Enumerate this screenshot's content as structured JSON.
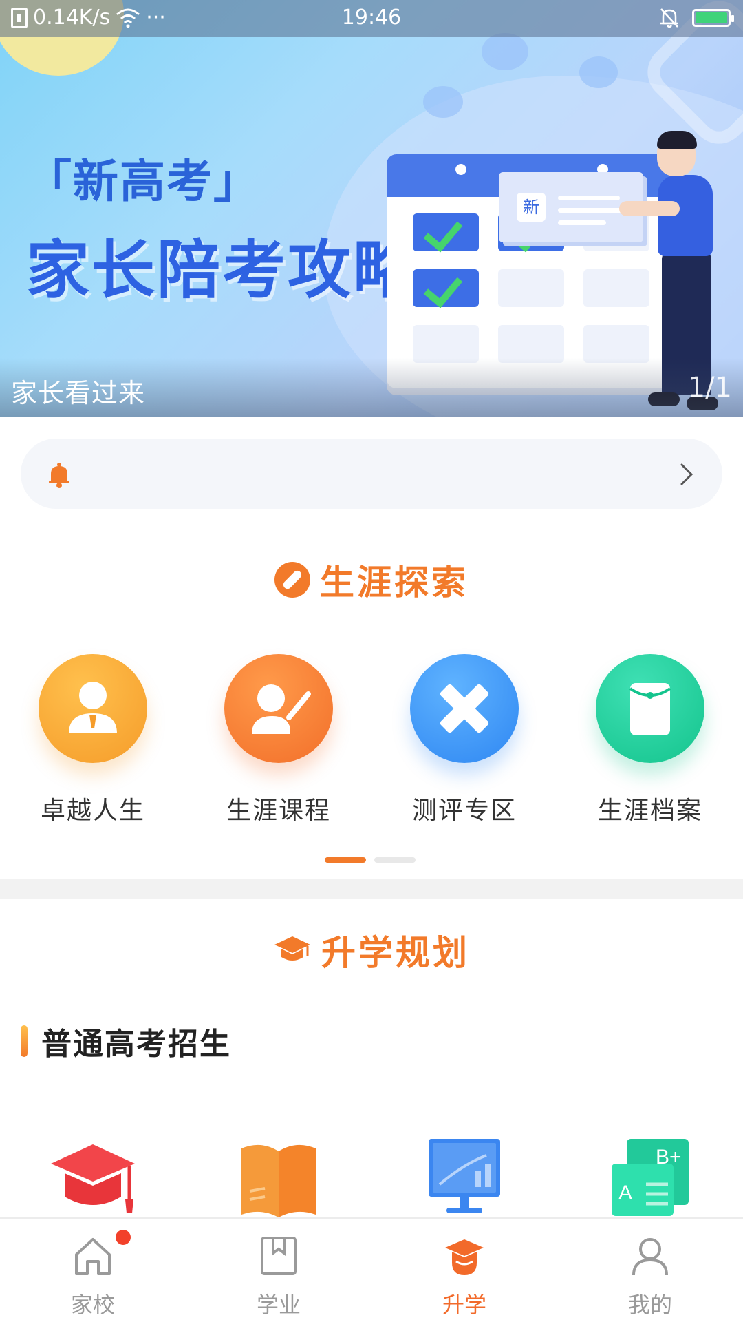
{
  "status_bar": {
    "speed": "0.14K/s",
    "dots": "···",
    "time": "19:46"
  },
  "banner": {
    "tag_title": "「新高考」",
    "main_title": "家长陪考攻略",
    "board_badge": "新",
    "caption": "家长看过来",
    "counter": "1/1"
  },
  "notice": {
    "text": ""
  },
  "career_section": {
    "title": "生涯探索",
    "items": [
      {
        "label": "卓越人生",
        "icon": "person-tie-icon"
      },
      {
        "label": "生涯课程",
        "icon": "teacher-board-icon"
      },
      {
        "label": "测评专区",
        "icon": "pencil-ruler-icon"
      },
      {
        "label": "生涯档案",
        "icon": "folder-icon"
      }
    ],
    "page_count": 2,
    "active_page": 1
  },
  "plan_section": {
    "title": "升学规划",
    "subtitle": "普通高考招生",
    "items": [
      {
        "icon": "graduation-cap-icon"
      },
      {
        "icon": "open-book-icon"
      },
      {
        "icon": "chart-monitor-icon"
      },
      {
        "icon": "grade-cards-icon",
        "text_b": "B+",
        "text_a": "A"
      }
    ]
  },
  "bottom_nav": {
    "items": [
      {
        "label": "家校",
        "icon": "home-icon",
        "active": false,
        "has_dot": true
      },
      {
        "label": "学业",
        "icon": "book-bookmark-icon",
        "active": false,
        "has_dot": false
      },
      {
        "label": "升学",
        "icon": "graduation-cap-icon",
        "active": true,
        "has_dot": false
      },
      {
        "label": "我的",
        "icon": "user-icon",
        "active": false,
        "has_dot": false
      }
    ]
  },
  "colors": {
    "accent": "#f27a2a",
    "banner_blue": "#2d62e2",
    "nav_active": "#f26a2a",
    "nav_inactive": "#9a9a9a"
  }
}
